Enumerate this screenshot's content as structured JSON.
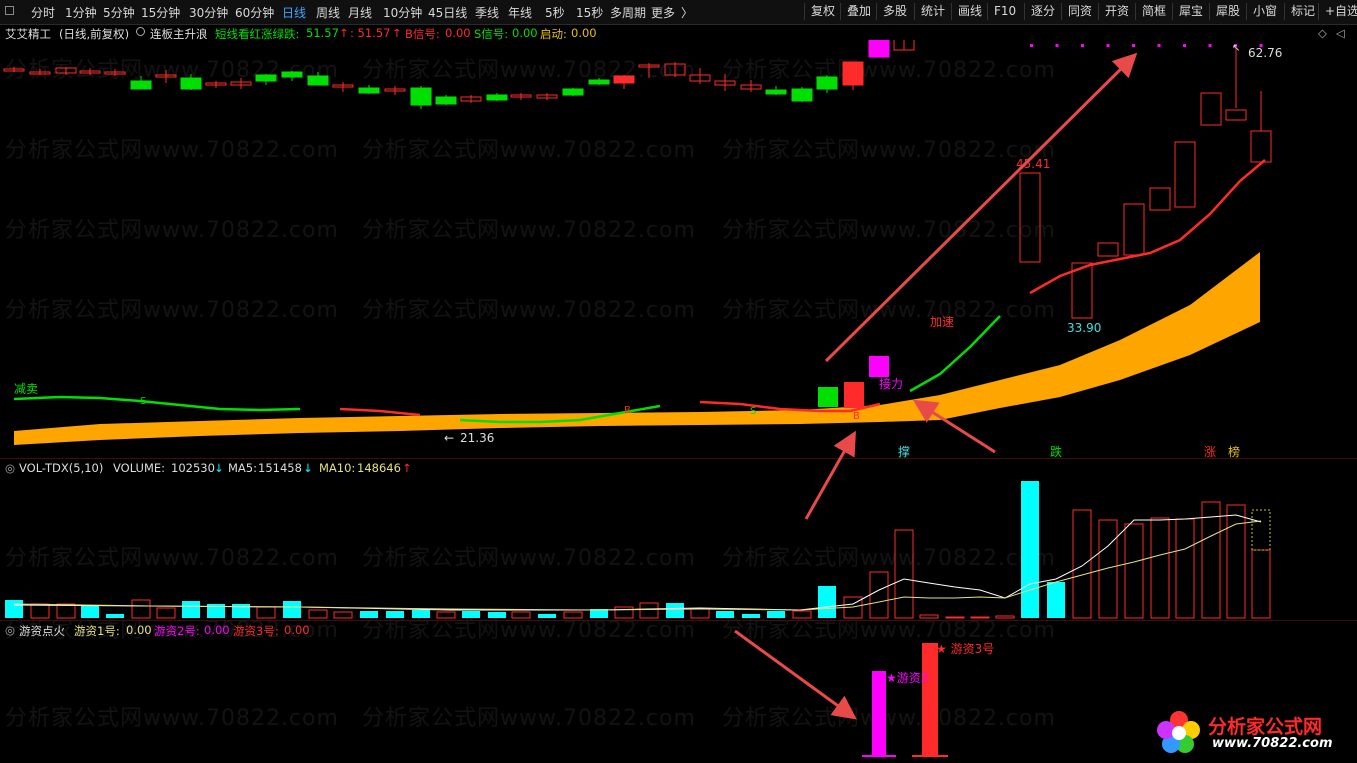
{
  "toolbar": {
    "periods": [
      "分时",
      "1分钟",
      "5分钟",
      "15分钟",
      "30分钟",
      "60分钟",
      "日线",
      "周线",
      "月线",
      "10分钟",
      "45日线",
      "季线",
      "年线",
      "5秒",
      "15秒",
      "多周期",
      "更多"
    ],
    "active_period": "日线",
    "more_chevron": "〉",
    "buttons": [
      "复权",
      "叠加",
      "多股",
      "统计",
      "画线",
      "F10",
      "逐分",
      "同资",
      "开资",
      "简框",
      "犀宝",
      "犀股",
      "小窗",
      "标记",
      "+自选"
    ]
  },
  "main_panel": {
    "stock_name": "艾艾精工",
    "mode": "(日线,前复权)",
    "indicator": "连板主升浪",
    "short_line_label": "短线看红涨绿跌:",
    "short_line_value": "51.57",
    "up_arrow": "↑",
    "colon_value": ": 51.57",
    "b_signal_label": "B信号:",
    "b_signal_value": "0.00",
    "s_signal_label": "S信号:",
    "s_signal_value": "0.00",
    "start_label": "启动:",
    "start_value": "0.00",
    "high_label": "62.76",
    "mid_high_label": "45.41",
    "low_label": "33.90",
    "bottom_low_label": "21.36",
    "left_arrow": "←",
    "reduce_sell_label": "减卖",
    "accelerate_label": "加速",
    "relay_label": "接力",
    "b_marker": "B",
    "s_marker": "S",
    "tags": [
      "撑",
      "跌",
      "涨",
      "榜"
    ]
  },
  "vol_panel": {
    "name": "VOL-TDX(5,10)",
    "volume_label": "VOLUME:",
    "volume_value": "102530",
    "ma5_label": "MA5:",
    "ma5_value": "151458",
    "ma10_label": "MA10:",
    "ma10_value": "148646",
    "down_arrow": "↓",
    "up_arrow": "↑"
  },
  "fire_panel": {
    "name": "游资点火",
    "f1_label": "游资1号:",
    "f1_value": "0.00",
    "f2_label": "游资2号:",
    "f2_value": "0.00",
    "f3_label": "游资3号:",
    "f3_value": "0.00",
    "bar2_label": "★游资2",
    "bar3_label": "★ 游资3号"
  },
  "watermark": "分析家公式网www.70822.com",
  "logo": {
    "title": "分析家公式网",
    "url": "www.70822.com"
  },
  "colors": {
    "up_red": "#ff2a2a",
    "down_cyan": "#00ffff",
    "bull_green": "#00e000",
    "band_orange": "#ffa500",
    "magenta": "#ff00ff",
    "ma_yellow": "#e6e080",
    "annotation_arrow": "#e84a4a"
  }
}
